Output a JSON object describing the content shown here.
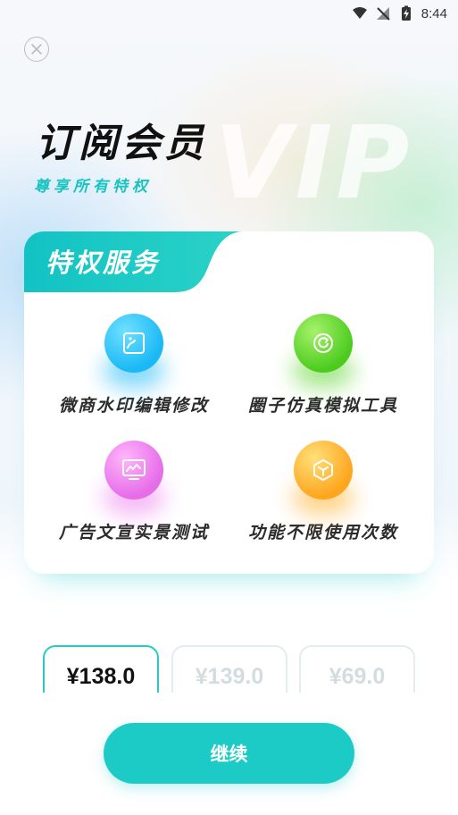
{
  "status_bar": {
    "time": "8:44",
    "icons": [
      "wifi-icon",
      "no-signal-icon",
      "battery-charging-icon"
    ]
  },
  "header": {
    "close_icon": "close-icon",
    "watermark": "VIP",
    "title": "订阅会员",
    "subtitle": "尊享所有特权"
  },
  "privileges": {
    "tab_label": "特权服务",
    "accent_color": "#1dcbc6",
    "items": [
      {
        "label": "微商水印编辑修改",
        "icon": "image-edit-icon",
        "color": "#1ab8f5"
      },
      {
        "label": "圈子仿真模拟工具",
        "icon": "refresh-icon",
        "color": "#5cd52c"
      },
      {
        "label": "广告文宣实景测试",
        "icon": "monitor-chart-icon",
        "color": "#ee7ff0"
      },
      {
        "label": "功能不限使用次数",
        "icon": "cube-icon",
        "color": "#ffb02a"
      }
    ]
  },
  "pricing": {
    "options": [
      {
        "price": "¥138.0",
        "selected": true
      },
      {
        "price": "¥139.0",
        "selected": false
      },
      {
        "price": "¥69.0",
        "selected": false
      }
    ]
  },
  "actions": {
    "continue_label": "继续"
  }
}
